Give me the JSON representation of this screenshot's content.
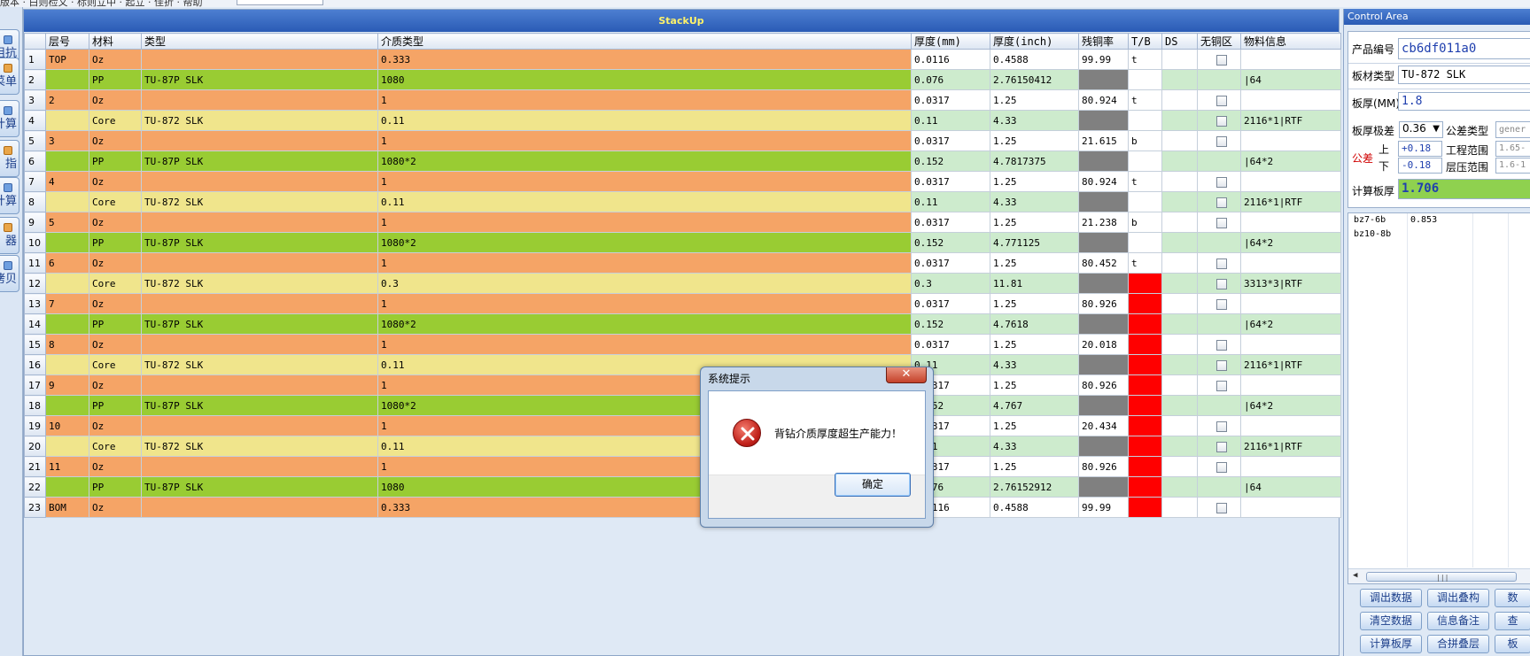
{
  "menubar": {
    "text": "版本 · 白则检文 · 标则立中 · 起立 · 佳折 · 帮助"
  },
  "left_toolbar": [
    {
      "label": "阻抗",
      "icon": "impedance-icon"
    },
    {
      "label": "菜单",
      "icon": "menu-list-icon"
    },
    {
      "label": "计算",
      "icon": "calc-icon"
    },
    {
      "label": "指",
      "icon": "pointer-icon"
    },
    {
      "label": "计算",
      "icon": "calc2-icon"
    },
    {
      "label": "器",
      "icon": "tool-icon"
    },
    {
      "label": "拷贝",
      "icon": "copy-icon"
    }
  ],
  "stackup": {
    "title": "StackUp",
    "columns": [
      "层号",
      "材料",
      "类型",
      "介质类型",
      "厚度(mm)",
      "厚度(inch)",
      "残铜率",
      "T/B",
      "DS",
      "无铜区",
      "物料信息"
    ],
    "rows": [
      {
        "n": "1",
        "layer": "TOP",
        "material": "Oz",
        "type": "",
        "dielectric": "0.333",
        "mm": "0.0116",
        "inch": "0.4588",
        "rc": "99.99",
        "tb": "t",
        "red": false,
        "cb": true,
        "info": "",
        "kind": "cu"
      },
      {
        "n": "2",
        "layer": "",
        "material": "PP",
        "type": "TU-87P SLK",
        "dielectric": "1080",
        "mm": "0.076",
        "inch": "2.76150412",
        "rc": "",
        "tb": "",
        "red": false,
        "cb": false,
        "info": "|64",
        "kind": "pp"
      },
      {
        "n": "3",
        "layer": "2",
        "material": "Oz",
        "type": "",
        "dielectric": "1",
        "mm": "0.0317",
        "inch": "1.25",
        "rc": "80.924",
        "tb": "t",
        "red": false,
        "cb": true,
        "info": "",
        "kind": "cu"
      },
      {
        "n": "4",
        "layer": "",
        "material": "Core",
        "type": "TU-872 SLK",
        "dielectric": "0.11",
        "mm": "0.11",
        "inch": "4.33",
        "rc": "",
        "tb": "",
        "red": false,
        "cb": true,
        "info": "2116*1|RTF",
        "kind": "core"
      },
      {
        "n": "5",
        "layer": "3",
        "material": "Oz",
        "type": "",
        "dielectric": "1",
        "mm": "0.0317",
        "inch": "1.25",
        "rc": "21.615",
        "tb": "b",
        "red": false,
        "cb": true,
        "info": "",
        "kind": "cu"
      },
      {
        "n": "6",
        "layer": "",
        "material": "PP",
        "type": "TU-87P SLK",
        "dielectric": "1080*2",
        "mm": "0.152",
        "inch": "4.7817375",
        "rc": "",
        "tb": "",
        "red": false,
        "cb": false,
        "info": "|64*2",
        "kind": "pp"
      },
      {
        "n": "7",
        "layer": "4",
        "material": "Oz",
        "type": "",
        "dielectric": "1",
        "mm": "0.0317",
        "inch": "1.25",
        "rc": "80.924",
        "tb": "t",
        "red": false,
        "cb": true,
        "info": "",
        "kind": "cu"
      },
      {
        "n": "8",
        "layer": "",
        "material": "Core",
        "type": "TU-872 SLK",
        "dielectric": "0.11",
        "mm": "0.11",
        "inch": "4.33",
        "rc": "",
        "tb": "",
        "red": false,
        "cb": true,
        "info": "2116*1|RTF",
        "kind": "core"
      },
      {
        "n": "9",
        "layer": "5",
        "material": "Oz",
        "type": "",
        "dielectric": "1",
        "mm": "0.0317",
        "inch": "1.25",
        "rc": "21.238",
        "tb": "b",
        "red": false,
        "cb": true,
        "info": "",
        "kind": "cu"
      },
      {
        "n": "10",
        "layer": "",
        "material": "PP",
        "type": "TU-87P SLK",
        "dielectric": "1080*2",
        "mm": "0.152",
        "inch": "4.771125",
        "rc": "",
        "tb": "",
        "red": false,
        "cb": false,
        "info": "|64*2",
        "kind": "pp"
      },
      {
        "n": "11",
        "layer": "6",
        "material": "Oz",
        "type": "",
        "dielectric": "1",
        "mm": "0.0317",
        "inch": "1.25",
        "rc": "80.452",
        "tb": "t",
        "red": false,
        "cb": true,
        "info": "",
        "kind": "cu"
      },
      {
        "n": "12",
        "layer": "",
        "material": "Core",
        "type": "TU-872 SLK",
        "dielectric": "0.3",
        "mm": "0.3",
        "inch": "11.81",
        "rc": "",
        "tb": "",
        "red": true,
        "cb": true,
        "info": "3313*3|RTF",
        "kind": "core"
      },
      {
        "n": "13",
        "layer": "7",
        "material": "Oz",
        "type": "",
        "dielectric": "1",
        "mm": "0.0317",
        "inch": "1.25",
        "rc": "80.926",
        "tb": "b",
        "red": true,
        "cb": true,
        "info": "",
        "kind": "cu"
      },
      {
        "n": "14",
        "layer": "",
        "material": "PP",
        "type": "TU-87P SLK",
        "dielectric": "1080*2",
        "mm": "0.152",
        "inch": "4.7618",
        "rc": "",
        "tb": "",
        "red": true,
        "cb": false,
        "info": "|64*2",
        "kind": "pp"
      },
      {
        "n": "15",
        "layer": "8",
        "material": "Oz",
        "type": "",
        "dielectric": "1",
        "mm": "0.0317",
        "inch": "1.25",
        "rc": "20.018",
        "tb": "t",
        "red": true,
        "cb": true,
        "info": "",
        "kind": "cu"
      },
      {
        "n": "16",
        "layer": "",
        "material": "Core",
        "type": "TU-872 SLK",
        "dielectric": "0.11",
        "mm": "0.11",
        "inch": "4.33",
        "rc": "",
        "tb": "",
        "red": true,
        "cb": true,
        "info": "2116*1|RTF",
        "kind": "core"
      },
      {
        "n": "17",
        "layer": "9",
        "material": "Oz",
        "type": "",
        "dielectric": "1",
        "mm": "0.0317",
        "inch": "1.25",
        "rc": "80.926",
        "tb": "b",
        "red": true,
        "cb": true,
        "info": "",
        "kind": "cu"
      },
      {
        "n": "18",
        "layer": "",
        "material": "PP",
        "type": "TU-87P SLK",
        "dielectric": "1080*2",
        "mm": "0.152",
        "inch": "4.767",
        "rc": "",
        "tb": "",
        "red": true,
        "cb": false,
        "info": "|64*2",
        "kind": "pp"
      },
      {
        "n": "19",
        "layer": "10",
        "material": "Oz",
        "type": "",
        "dielectric": "1",
        "mm": "0.0317",
        "inch": "1.25",
        "rc": "20.434",
        "tb": "t",
        "red": true,
        "cb": true,
        "info": "",
        "kind": "cu"
      },
      {
        "n": "20",
        "layer": "",
        "material": "Core",
        "type": "TU-872 SLK",
        "dielectric": "0.11",
        "mm": "0.11",
        "inch": "4.33",
        "rc": "",
        "tb": "",
        "red": true,
        "cb": true,
        "info": "2116*1|RTF",
        "kind": "core"
      },
      {
        "n": "21",
        "layer": "11",
        "material": "Oz",
        "type": "",
        "dielectric": "1",
        "mm": "0.0317",
        "inch": "1.25",
        "rc": "80.926",
        "tb": "b",
        "red": true,
        "cb": true,
        "info": "",
        "kind": "cu"
      },
      {
        "n": "22",
        "layer": "",
        "material": "PP",
        "type": "TU-87P SLK",
        "dielectric": "1080",
        "mm": "0.076",
        "inch": "2.76152912",
        "rc": "",
        "tb": "",
        "red": true,
        "cb": false,
        "info": "|64",
        "kind": "pp"
      },
      {
        "n": "23",
        "layer": "BOM",
        "material": "Oz",
        "type": "",
        "dielectric": "0.333",
        "mm": "0.0116",
        "inch": "0.4588",
        "rc": "99.99",
        "tb": "b",
        "red": true,
        "cb": true,
        "info": "",
        "kind": "cu"
      }
    ]
  },
  "control": {
    "title": "Control Area",
    "product_no_label": "产品编号",
    "product_no": "cb6df011a0",
    "material_label": "板材类型",
    "material": "TU-872 SLK",
    "thickness_label": "板厚(MM)",
    "thickness": "1.8",
    "tol_level_label": "板厚极差",
    "tol_level": "0.36",
    "tol_type_label": "公差类型",
    "tol_type": "gener",
    "tol_label": "公差",
    "up_label": "上",
    "down_label": "下",
    "tol_up": "+0.18",
    "tol_down": "-0.18",
    "eng_range_label": "工程范围",
    "eng_range": "1.65-",
    "press_range_label": "层压范围",
    "press_range": "1.6-1",
    "calc_label": "计算板厚",
    "calc_value": "1.706",
    "list": [
      {
        "name": "bz7-6b",
        "value": "0.853"
      },
      {
        "name": "bz10-8b",
        "value": ""
      }
    ],
    "buttons": [
      {
        "label": "调出数据",
        "id": "load-data"
      },
      {
        "label": "调出叠构",
        "id": "load-stack"
      },
      {
        "label": "数",
        "id": "data"
      },
      {
        "label": "清空数据",
        "id": "clear-data"
      },
      {
        "label": "信息备注",
        "id": "info-note"
      },
      {
        "label": "查",
        "id": "query"
      },
      {
        "label": "计算板厚",
        "id": "calc-thickness"
      },
      {
        "label": "合拼叠层",
        "id": "merge-stack"
      },
      {
        "label": "板",
        "id": "board"
      }
    ]
  },
  "dialog": {
    "title": "系统提示",
    "close": "✕",
    "message": "背钻介质厚度超生产能力！",
    "ok": "确定"
  },
  "colors": {
    "copper": "#f5a466",
    "prepreg": "#99cc33",
    "core": "#f0e58c",
    "pale_green": "#cdebcd",
    "gray_cell": "#808080",
    "warn_red": "#ff0000",
    "header_blue": "#2a5bb5"
  }
}
